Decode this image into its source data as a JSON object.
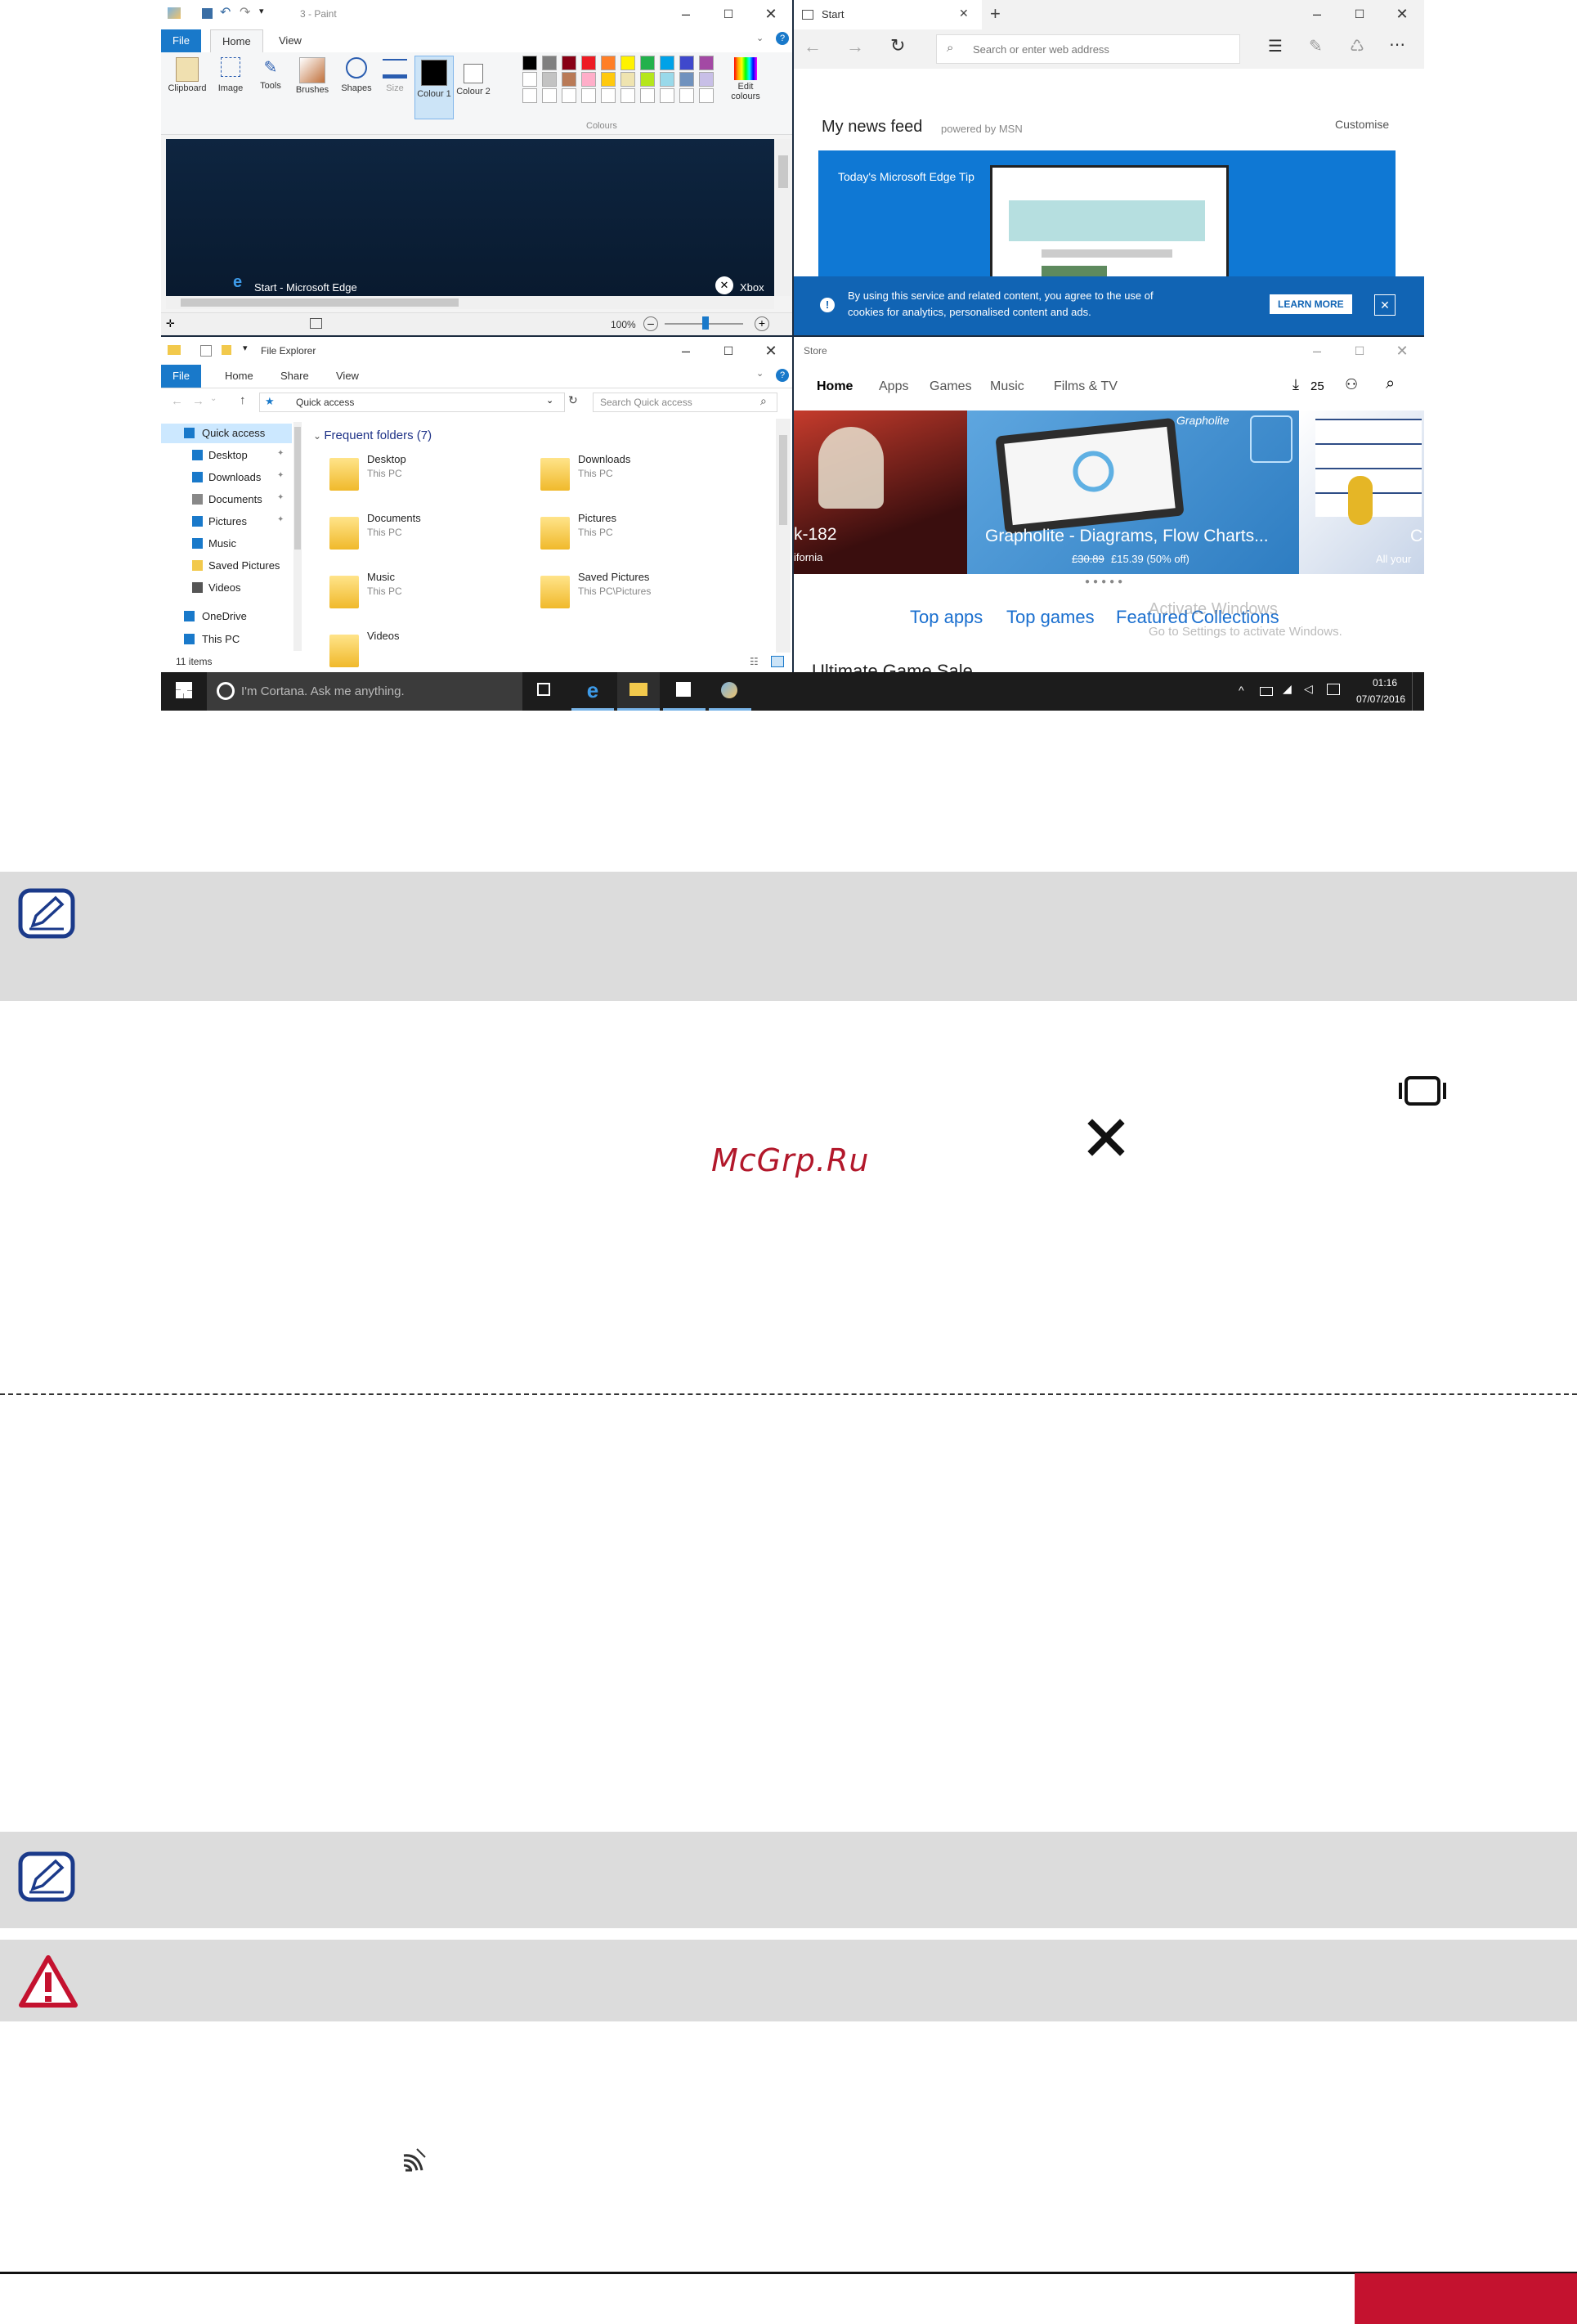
{
  "paint": {
    "title": "3 - Paint",
    "tabs": [
      "File",
      "Home",
      "View"
    ],
    "groups": [
      "Clipboard",
      "Image",
      "Tools",
      "Brushes",
      "Shapes",
      "Size",
      "Colour 1",
      "Colour 2",
      "Edit colours"
    ],
    "colours_label": "Colours",
    "canvas_text_left": "Start - Microsoft Edge",
    "canvas_text_right": "Xbox",
    "zoom": "100%",
    "palette": [
      "#000000",
      "#7f7f7f",
      "#880015",
      "#ed1c24",
      "#ff7f27",
      "#fff200",
      "#22b14c",
      "#00a2e8",
      "#3f48cc",
      "#a349a4",
      "#ffffff",
      "#c3c3c3",
      "#b97a57",
      "#ffaec9",
      "#ffc90e",
      "#efe4b0",
      "#b5e61d",
      "#99d9ea",
      "#7092be",
      "#c8bfe7"
    ]
  },
  "edge": {
    "tab_title": "Start",
    "address_placeholder": "Search or enter web address",
    "news_title": "My news feed",
    "powered": "powered by MSN",
    "customise": "Customise",
    "tip": "Today's Microsoft Edge Tip",
    "cookie_text_1": "By using this service and related content, you agree to the use of",
    "cookie_text_2": "cookies for analytics, personalised content and ads.",
    "learn_more": "LEARN MORE"
  },
  "explorer": {
    "title": "File Explorer",
    "tabs": [
      "File",
      "Home",
      "Share",
      "View"
    ],
    "address": "Quick access",
    "search_placeholder": "Search Quick access",
    "nav": [
      "Quick access",
      "Desktop",
      "Downloads",
      "Documents",
      "Pictures",
      "Music",
      "Saved Pictures",
      "Videos",
      "OneDrive",
      "This PC"
    ],
    "section": "Frequent folders (7)",
    "folders": [
      {
        "name": "Desktop",
        "loc": "This PC"
      },
      {
        "name": "Downloads",
        "loc": "This PC"
      },
      {
        "name": "Documents",
        "loc": "This PC"
      },
      {
        "name": "Pictures",
        "loc": "This PC"
      },
      {
        "name": "Music",
        "loc": "This PC"
      },
      {
        "name": "Saved Pictures",
        "loc": "This PC\\Pictures"
      },
      {
        "name": "Videos",
        "loc": ""
      }
    ],
    "status": "11 items"
  },
  "store": {
    "title": "Store",
    "nav": [
      "Home",
      "Apps",
      "Games",
      "Music",
      "Films & TV"
    ],
    "downloads": "25",
    "hero_left_title": "k-182",
    "hero_left_sub": "ifornia",
    "hero_mid_title": "Grapholite - Diagrams, Flow Charts...",
    "hero_mid_old_price": "£30.89",
    "hero_mid_price": "£15.39 (50% off)",
    "hero_mid_brand": "Grapholite",
    "hero_right_sub": "All your",
    "hero_right_title": "C",
    "links": [
      "Top apps",
      "Top games",
      "Featured",
      "Collections"
    ],
    "activate_1": "Activate Windows",
    "activate_2": "Go to Settings to activate Windows.",
    "cut_text": "Ultimate Game Sale"
  },
  "taskbar": {
    "cortana": "I'm Cortana. Ask me anything.",
    "time": "01:16",
    "date": "07/07/2016"
  },
  "watermark": "McGrp.Ru"
}
